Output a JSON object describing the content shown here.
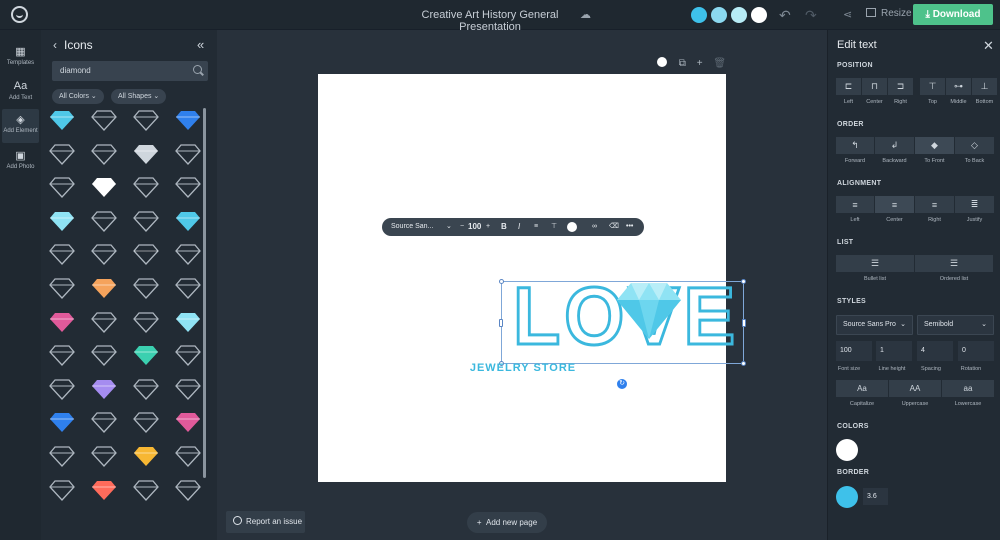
{
  "topbar": {
    "title": "Creative Art History General Presentation",
    "swatches": [
      "#3ec1ea",
      "#8bd9f0",
      "#b7ecf6",
      "#ffffff"
    ],
    "resize_label": "Resize",
    "download_label": "Download"
  },
  "rail": [
    {
      "label": "Templates",
      "icon": "templates-icon"
    },
    {
      "label": "Add Text",
      "icon": "text-icon"
    },
    {
      "label": "Add Element",
      "icon": "shapes-icon"
    },
    {
      "label": "Add Photo",
      "icon": "photo-icon"
    }
  ],
  "icons_panel": {
    "title": "Icons",
    "search_value": "diamond",
    "filters": [
      "All Colors",
      "All Shapes"
    ]
  },
  "canvas": {
    "text_toolbar": {
      "font": "Source San...",
      "size": "100"
    },
    "headline": "LOVE",
    "subline": "JEWELRY STORE",
    "report_label": "Report an issue",
    "new_page_label": "Add new page"
  },
  "edit_panel": {
    "title": "Edit text",
    "position": {
      "heading": "POSITION",
      "labels": [
        "Left",
        "Center",
        "Right",
        "Top",
        "Middle",
        "Bottom"
      ]
    },
    "order": {
      "heading": "ORDER",
      "labels": [
        "Forward",
        "Backward",
        "To Front",
        "To Back"
      ]
    },
    "alignment": {
      "heading": "ALIGNMENT",
      "labels": [
        "Left",
        "Center",
        "Right",
        "Justify"
      ]
    },
    "list": {
      "heading": "LIST",
      "labels": [
        "Bullet list",
        "Ordered list"
      ]
    },
    "styles": {
      "heading": "STYLES",
      "font": "Source Sans Pro",
      "weight": "Semibold",
      "values": [
        "100",
        "1",
        "4",
        "0"
      ],
      "value_labels": [
        "Font size",
        "Line height",
        "Spacing",
        "Rotation"
      ],
      "case_buttons": [
        "Aa",
        "AA",
        "aa"
      ],
      "case_labels": [
        "Capitalize",
        "Uppercase",
        "Lowercase"
      ]
    },
    "colors": {
      "heading": "COLORS",
      "value": "#ffffff"
    },
    "border": {
      "heading": "BORDER",
      "color": "#3ec1ea",
      "value": "3.6"
    }
  }
}
